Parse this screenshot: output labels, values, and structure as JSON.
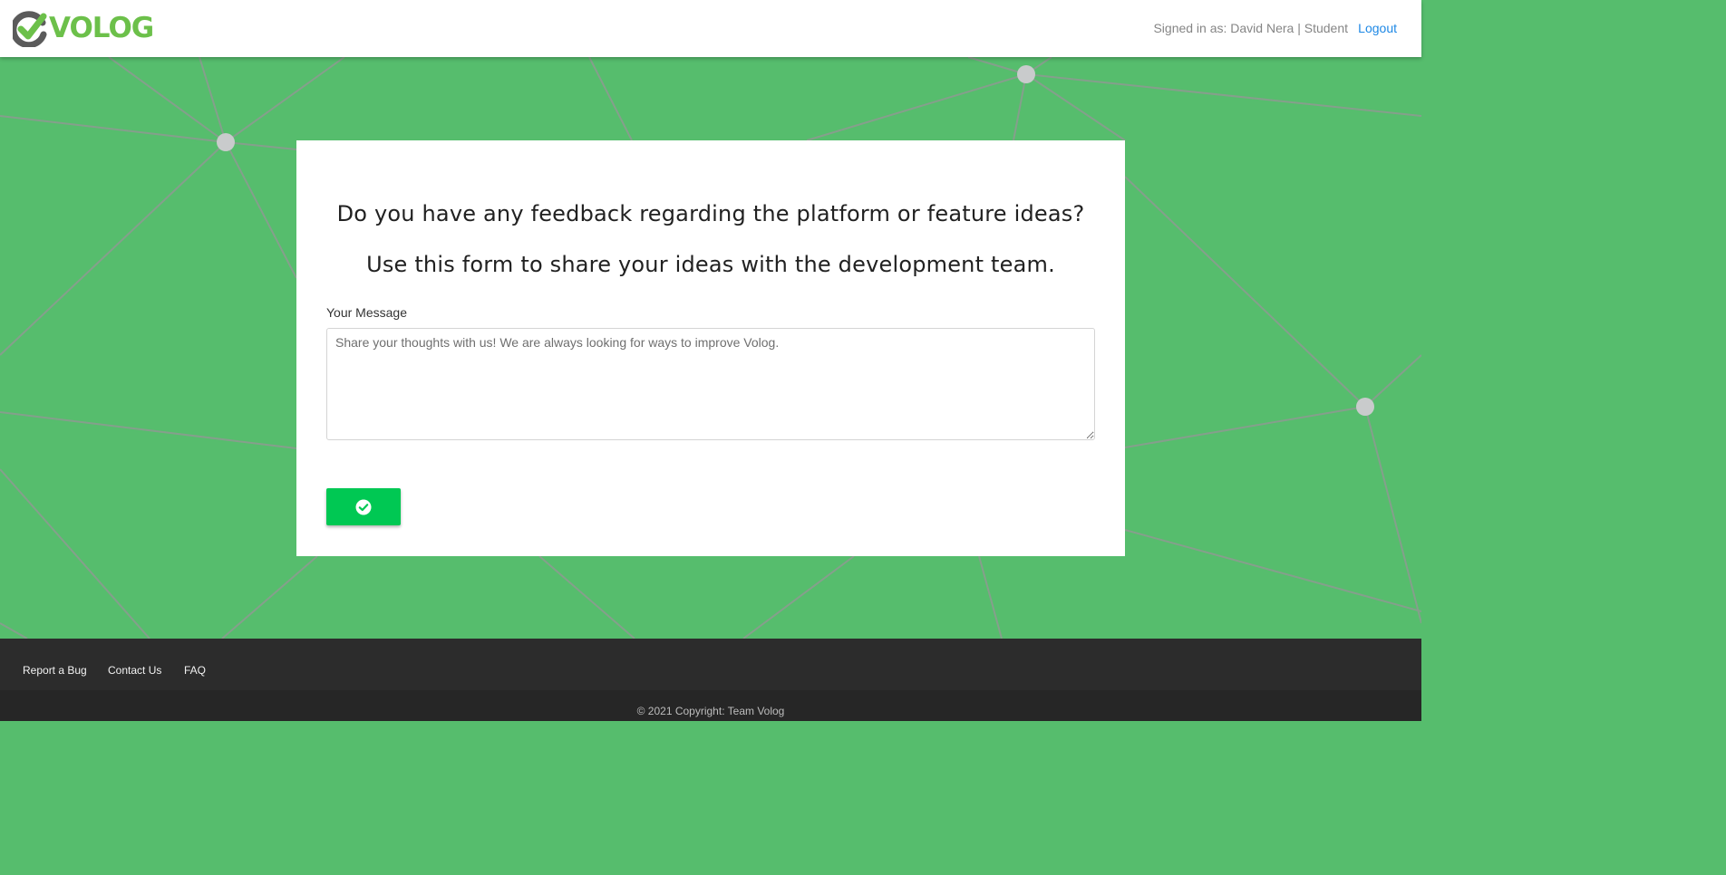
{
  "header": {
    "logo_text": "VOLOG",
    "signed_in_text": "Signed in as: David Nera | Student",
    "logout_label": "Logout"
  },
  "feedback": {
    "heading": "Do you have any feedback regarding the platform or feature ideas?",
    "subheading": "Use this form to share your ideas with the development team.",
    "message_label": "Your Message",
    "message_placeholder": "Share your thoughts with us! We are always looking for ways to improve Volog.",
    "message_value": "",
    "submit_icon": "check-circle-icon"
  },
  "footer": {
    "links": [
      "Report a Bug",
      "Contact Us",
      "FAQ"
    ],
    "copyright": "© 2021 Copyright: Team Volog"
  },
  "colors": {
    "background": "#56bd6d",
    "brand_green": "#6cc04a",
    "submit_button": "#00c853",
    "logout_link": "#1e88e5",
    "footer": "#2c2c2c"
  }
}
